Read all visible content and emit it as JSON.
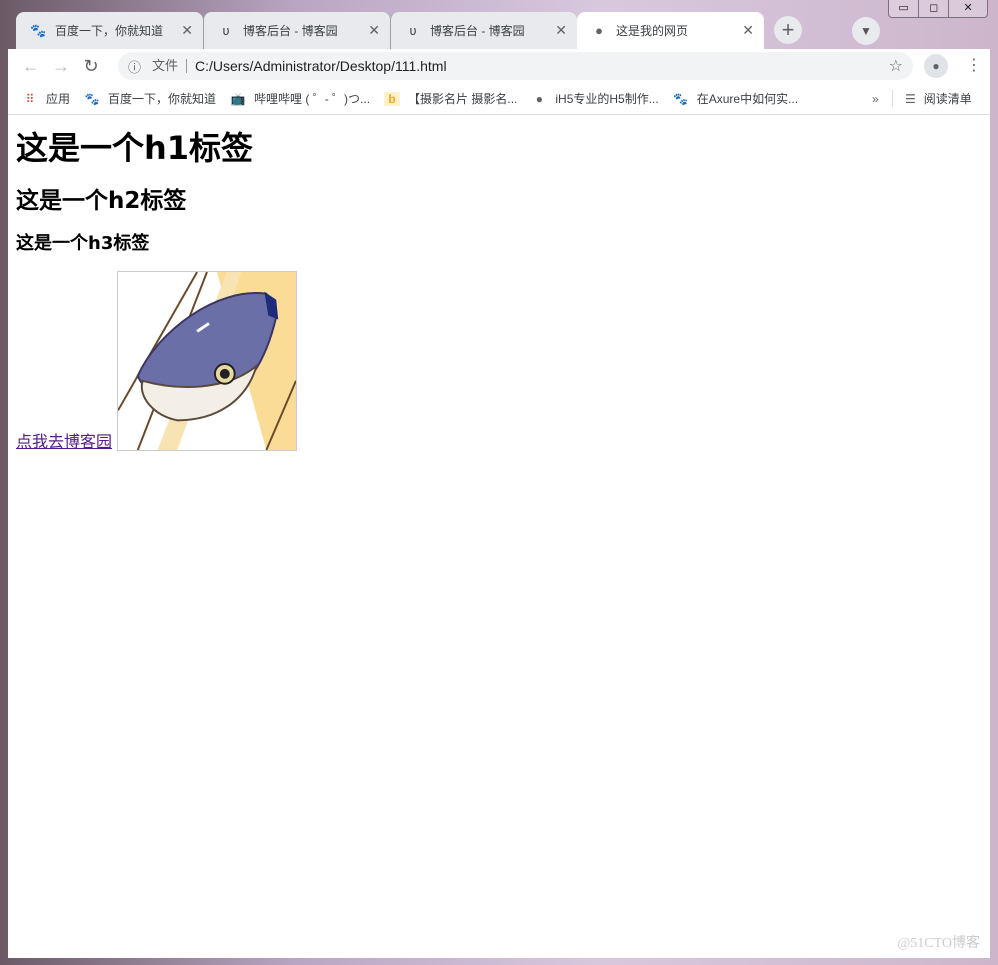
{
  "tabs": [
    {
      "title": "百度一下，你就知道",
      "icon": "baidu-paw-icon"
    },
    {
      "title": "博客后台 - 博客园",
      "icon": "cnblogs-icon"
    },
    {
      "title": "博客后台 - 博客园",
      "icon": "cnblogs-icon"
    },
    {
      "title": "这是我的网页",
      "icon": "globe-icon",
      "active": true
    }
  ],
  "omnibox": {
    "scheme_label": "文件",
    "url": "C:/Users/Administrator/Desktop/111.html"
  },
  "bookmarks": [
    {
      "label": "应用",
      "icon": "apps-grid-icon"
    },
    {
      "label": "百度一下，你就知道",
      "icon": "baidu-paw-icon"
    },
    {
      "label": "哔哩哔哩 ( ゜- ゜)つ...",
      "icon": "bilibili-icon"
    },
    {
      "label": "【摄影名片 摄影名...",
      "icon": "b-logo-icon"
    },
    {
      "label": "iH5专业的H5制作...",
      "icon": "globe-icon"
    },
    {
      "label": "在Axure中如何实...",
      "icon": "baidu-paw-icon"
    }
  ],
  "reading_list": "阅读清单",
  "page": {
    "h1": "这是一个h1标签",
    "h2": "这是一个h2标签",
    "h3": "这是一个h3标签",
    "link": "点我去博客园"
  },
  "watermark": "@51CTO博客"
}
